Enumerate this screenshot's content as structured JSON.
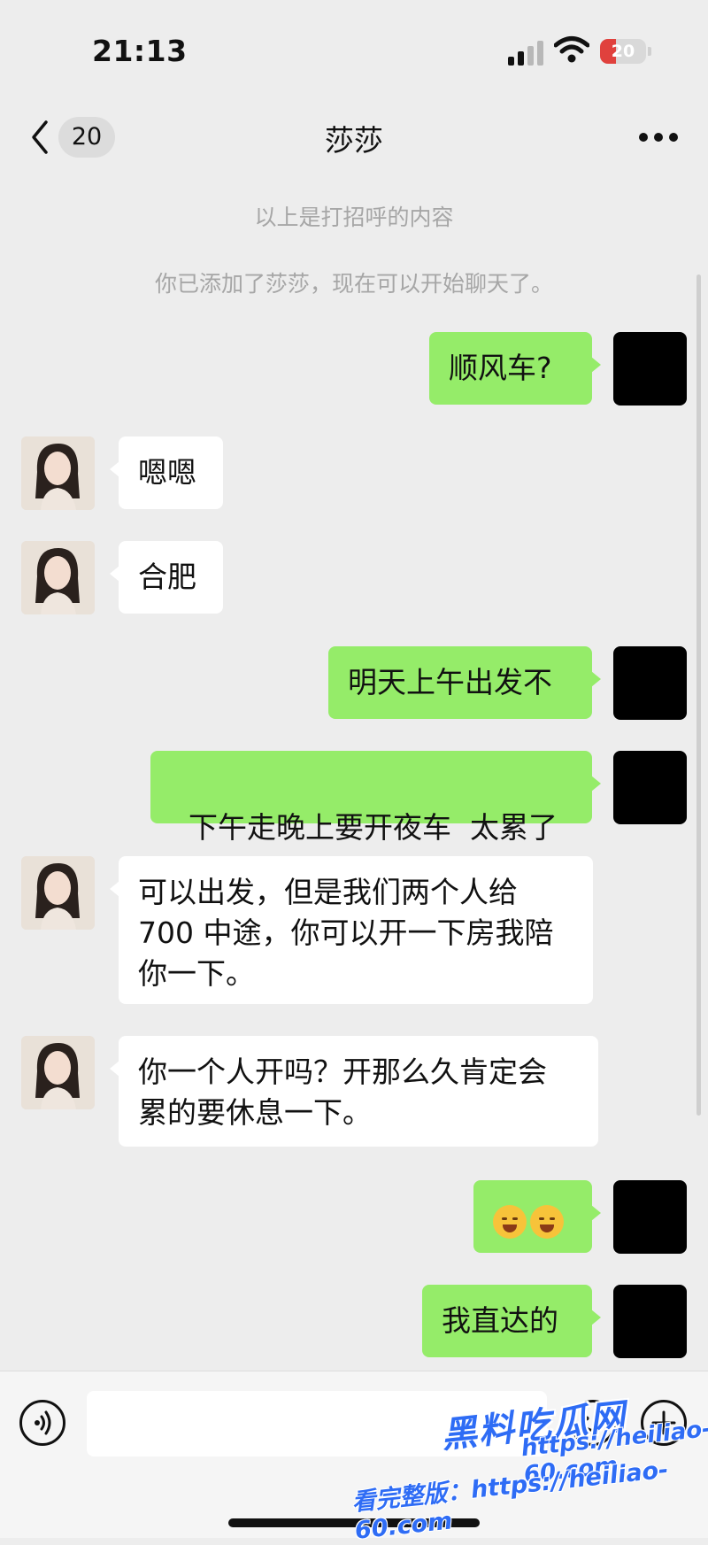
{
  "status_bar": {
    "time": "21:13",
    "battery": "20"
  },
  "nav": {
    "unread_count": "20",
    "title": "莎莎"
  },
  "system_messages": [
    "以上是打招呼的内容",
    "你已添加了莎莎，现在可以开始聊天了。"
  ],
  "messages": [
    {
      "sender": "me",
      "text": "顺风车?"
    },
    {
      "sender": "her",
      "text": "嗯嗯"
    },
    {
      "sender": "her",
      "text": "合肥"
    },
    {
      "sender": "me",
      "text": "明天上午出发不"
    },
    {
      "sender": "me",
      "text": "下午走晚上要开夜车  太累了"
    },
    {
      "sender": "her",
      "lines": [
        "可以出发，但是我们两个人给",
        "700 中途，你可以开一下房我陪",
        "你一下。"
      ]
    },
    {
      "sender": "her",
      "lines": [
        "你一个人开吗？开那么久肯定会",
        "累的要休息一下。"
      ]
    },
    {
      "sender": "me",
      "emoji": [
        "laughing-crying-emoji",
        "laughing-crying-emoji"
      ]
    },
    {
      "sender": "me",
      "text": "我直达的"
    }
  ],
  "input": {
    "value": ""
  },
  "watermark": {
    "logo": "黑料吃瓜网",
    "domain": "https://heiliao-60.com",
    "text": "看完整版：https://heiliao-60.com"
  },
  "colors": {
    "background": "#ededed",
    "my_bubble": "#95ec69",
    "her_bubble": "#ffffff",
    "watermark": "#2e6cf5"
  }
}
